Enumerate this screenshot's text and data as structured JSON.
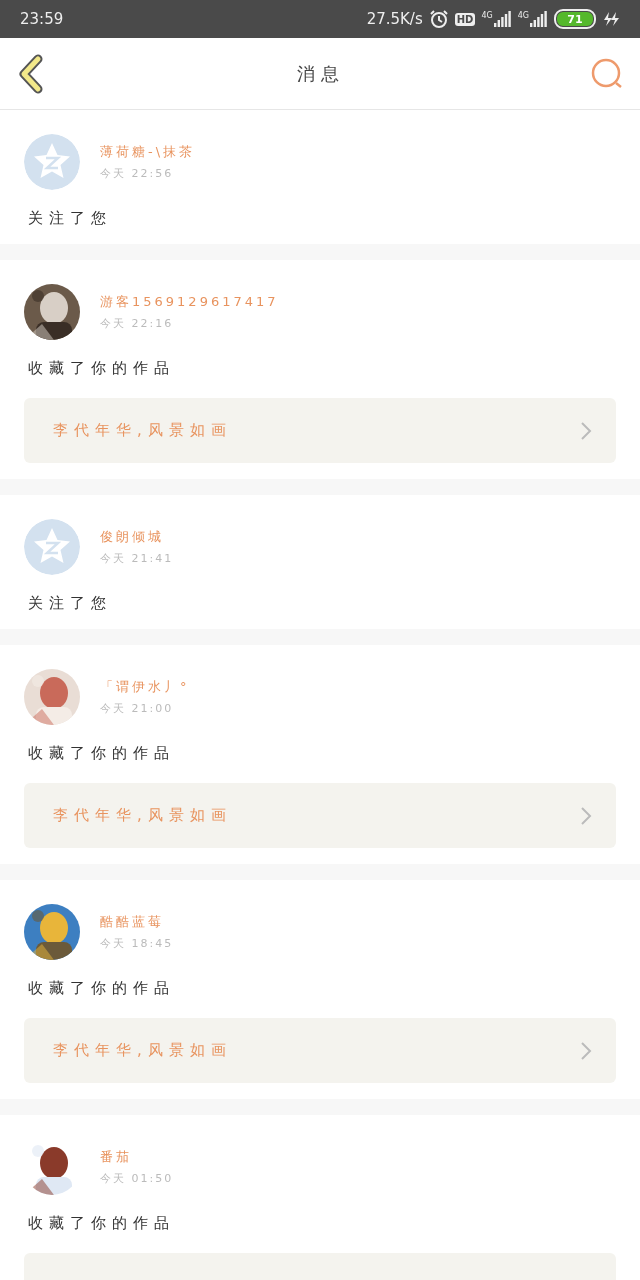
{
  "status_bar": {
    "time": "23:59",
    "speed": "27.5K/s",
    "hd": "HD",
    "networks": [
      "4G",
      "4G"
    ],
    "battery": "71"
  },
  "header": {
    "title": "消 息"
  },
  "messages": [
    {
      "avatar": {
        "kind": "default"
      },
      "name": "薄荷糖-\\抹茶",
      "time": "今天 22:56",
      "action": "关注了您"
    },
    {
      "name": "游客1569129617417",
      "time": "今天 22:16",
      "action": "收藏了你的作品",
      "work": {
        "kind": "link",
        "title": "李代年华,风景如画"
      }
    },
    {
      "avatar": {
        "kind": "default"
      },
      "name": "俊朗倾城",
      "time": "今天 21:41",
      "action": "关注了您"
    },
    {
      "name": "「谓伊水丿°",
      "time": "今天 21:00",
      "action": "收藏了你的作品",
      "work": {
        "kind": "link",
        "title": "李代年华,风景如画"
      }
    },
    {
      "name": "酷酷蓝莓",
      "time": "今天 18:45",
      "action": "收藏了你的作品",
      "work": {
        "kind": "link",
        "title": "李代年华,风景如画"
      }
    },
    {
      "name": "番茄",
      "time": "今天 01:50",
      "action": "收藏了你的作品",
      "work": {
        "kind": "cut"
      }
    }
  ]
}
